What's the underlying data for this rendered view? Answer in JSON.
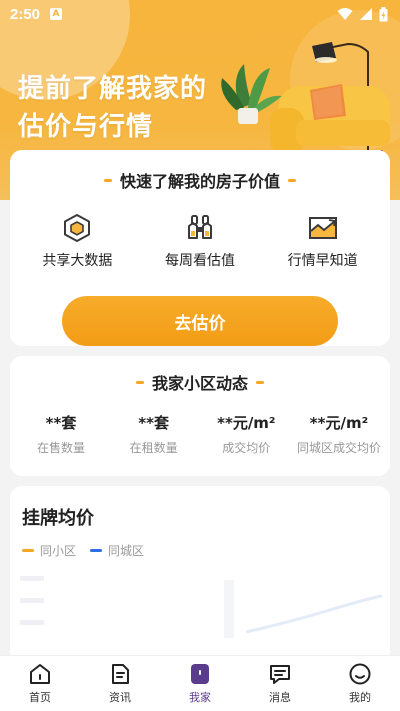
{
  "status_bar": {
    "time": "2:50",
    "badge": "A"
  },
  "hero": {
    "title_line1": "提前了解我家的",
    "title_line2": "估价与行情"
  },
  "valuation_card": {
    "heading": "快速了解我的房子价值",
    "features": [
      {
        "icon": "cube-data-icon",
        "label": "共享大数据"
      },
      {
        "icon": "binoculars-icon",
        "label": "每周看估值"
      },
      {
        "icon": "trend-chart-icon",
        "label": "行情早知道"
      }
    ],
    "cta_label": "去估价"
  },
  "community_card": {
    "heading": "我家小区动态",
    "stats": [
      {
        "value": "**套",
        "label": "在售数量"
      },
      {
        "value": "**套",
        "label": "在租数量"
      },
      {
        "value": "**元/m²",
        "label": "成交均价"
      },
      {
        "value": "**元/m²",
        "label": "同城区成交均价"
      }
    ]
  },
  "listing_card": {
    "title": "挂牌均价",
    "legend": [
      {
        "label": "同小区",
        "color": "#f6a623"
      },
      {
        "label": "同城区",
        "color": "#2f6fe4"
      }
    ]
  },
  "tab_bar": {
    "tabs": [
      {
        "icon": "home-icon",
        "label": "首页",
        "active": false
      },
      {
        "icon": "news-icon",
        "label": "资讯",
        "active": false
      },
      {
        "icon": "my-home-icon",
        "label": "我家",
        "active": true
      },
      {
        "icon": "message-icon",
        "label": "消息",
        "active": false
      },
      {
        "icon": "profile-icon",
        "label": "我的",
        "active": false
      }
    ]
  },
  "colors": {
    "accent": "#f6a623",
    "active_tab": "#5b3b8c",
    "series_blue": "#2f6fe4"
  }
}
